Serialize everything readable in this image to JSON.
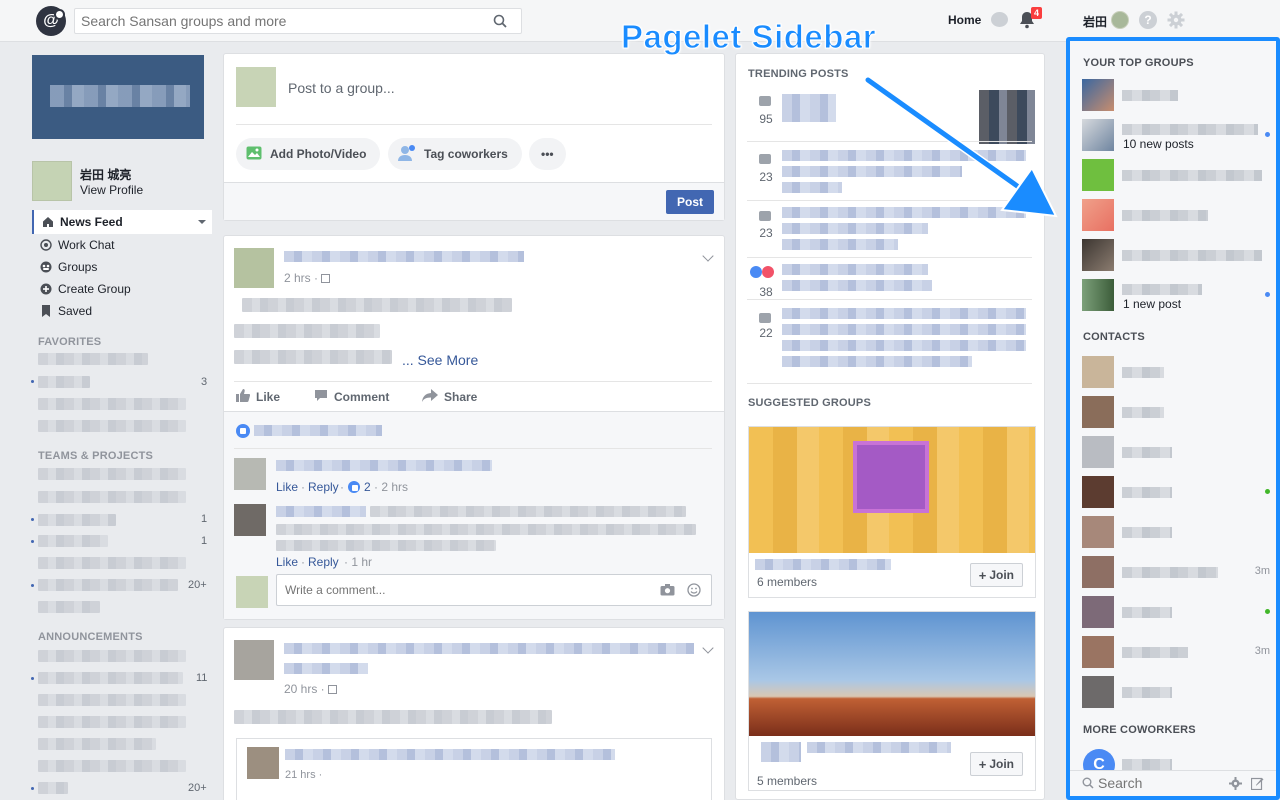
{
  "topbar": {
    "search_placeholder": "Search Sansan groups and more",
    "home": "Home",
    "notif_count": "4",
    "user": "岩田",
    "help": "?"
  },
  "annotation": {
    "title": "Pagelet Sidebar"
  },
  "left": {
    "profile_name": "岩田 城亮",
    "view_profile": "View Profile",
    "nav": [
      {
        "label": "News Feed",
        "icon": "newsfeed-icon"
      },
      {
        "label": "Work Chat",
        "icon": "workchat-icon"
      },
      {
        "label": "Groups",
        "icon": "groups-icon"
      },
      {
        "label": "Create Group",
        "icon": "plus-icon"
      },
      {
        "label": "Saved",
        "icon": "bookmark-icon"
      }
    ],
    "favorites_title": "FAVORITES",
    "favorites_count": "3",
    "teams_title": "TEAMS & PROJECTS",
    "teams_counts": [
      "1",
      "1",
      "20+"
    ],
    "announcements_title": "ANNOUNCEMENTS",
    "announcements_counts": [
      "11",
      "20+"
    ]
  },
  "composer": {
    "placeholder": "Post to a group...",
    "add_photo": "Add Photo/Video",
    "tag": "Tag coworkers",
    "more": "•••",
    "post": "Post"
  },
  "post1": {
    "time": "2 hrs · ",
    "see_more": "... See More",
    "like": "Like",
    "comment": "Comment",
    "share": "Share",
    "c1_like": "Like",
    "c1_reply": "Reply",
    "c1_reactions": "2",
    "c1_time": "· 2 hrs",
    "c2_like": "Like",
    "c2_reply": "Reply",
    "c2_time": "· 1 hr",
    "write_placeholder": "Write a comment..."
  },
  "post2": {
    "time": "20 hrs · ",
    "shared_time": "21 hrs · "
  },
  "trending": {
    "title": "TRENDING POSTS",
    "counts": [
      "95",
      "23",
      "23",
      "38",
      "22"
    ],
    "suggested_title": "SUGGESTED GROUPS",
    "group1_members": "6 members",
    "group2_members": "5 members",
    "join": "Join"
  },
  "sidebar": {
    "top_groups_title": "YOUR TOP GROUPS",
    "group2_sub": "10 new posts",
    "group6_sub": "1 new post",
    "contacts_title": "CONTACTS",
    "contact_times": [
      "3m",
      "3m"
    ],
    "more_title": "MORE COWORKERS",
    "coworker_initial": "C",
    "search_placeholder": "Search"
  },
  "colors": {
    "brand": "#4267b2",
    "annotation": "#1a8cff",
    "online": "#42b72a",
    "badge": "#fa3e3e"
  }
}
